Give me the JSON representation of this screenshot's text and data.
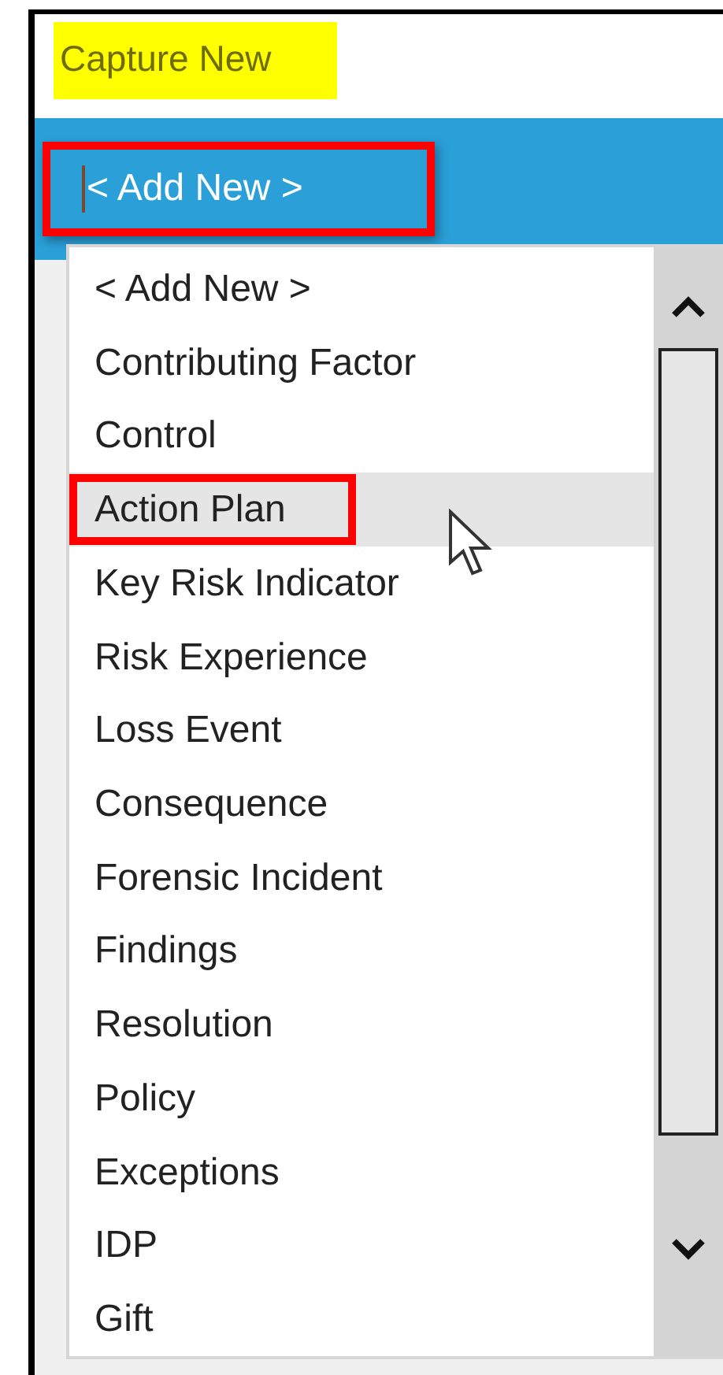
{
  "header": {
    "title": "Capture New"
  },
  "combo": {
    "value": "< Add New >",
    "expanded": true
  },
  "dropdown": {
    "items": [
      {
        "label": "< Add New >",
        "selected": false
      },
      {
        "label": "Contributing Factor",
        "selected": false
      },
      {
        "label": "Control",
        "selected": false
      },
      {
        "label": "Action Plan",
        "selected": true
      },
      {
        "label": "Key Risk Indicator",
        "selected": false
      },
      {
        "label": "Risk Experience",
        "selected": false
      },
      {
        "label": "Loss Event",
        "selected": false
      },
      {
        "label": "Consequence",
        "selected": false
      },
      {
        "label": "Forensic Incident",
        "selected": false
      },
      {
        "label": "Findings",
        "selected": false
      },
      {
        "label": "Resolution",
        "selected": false
      },
      {
        "label": "Policy",
        "selected": false
      },
      {
        "label": "Exceptions",
        "selected": false
      },
      {
        "label": "IDP",
        "selected": false
      },
      {
        "label": "Gift",
        "selected": false
      }
    ]
  }
}
